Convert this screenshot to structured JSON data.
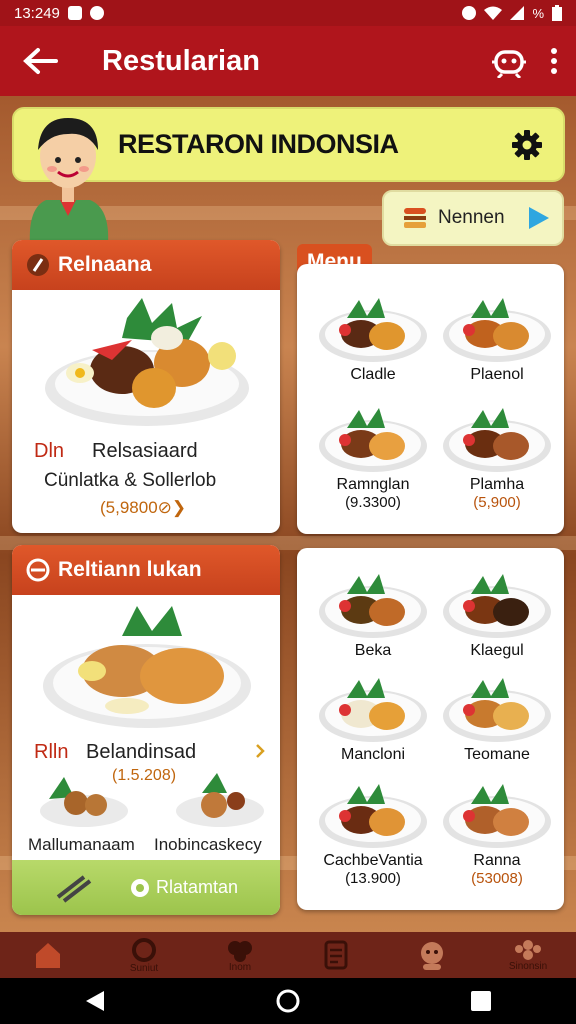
{
  "status_bar": {
    "time": "13:249",
    "battery": "%"
  },
  "app_bar": {
    "title": "Restularian"
  },
  "banner": {
    "title": "RESTARON INDONSIA"
  },
  "menu_button": {
    "label": "Nennen"
  },
  "left_card_1": {
    "header": "Relnaana",
    "line1_prefix": "Dln",
    "line1": "Relsasiaard",
    "line2": "Cünlatka & Sollerlob",
    "price": "(5,9800⊘❯"
  },
  "menu_tag": "Menu",
  "menu_grid_top": [
    {
      "name": "Cladle",
      "price": ""
    },
    {
      "name": "Plaenol",
      "price": ""
    },
    {
      "name": "Ramnglan",
      "price": "(9.3300)"
    },
    {
      "name": "Plamha",
      "price": "(5,900)"
    }
  ],
  "left_card_2": {
    "header": "Reltiann lukan",
    "line1_prefix": "Rlln",
    "line1": "Belandinsad",
    "price": "(1.5.208)",
    "item1": "Mallumanaam",
    "item2": "Inobincaskecy",
    "footer_label": "Rlatamtan"
  },
  "menu_grid_bottom": [
    {
      "name": "Beka",
      "price": ""
    },
    {
      "name": "Klaegul",
      "price": ""
    },
    {
      "name": "Mancloni",
      "price": ""
    },
    {
      "name": "Teomane",
      "price": ""
    },
    {
      "name": "CachbeVantia",
      "price": "(13.900)"
    },
    {
      "name": "Ranna",
      "price": "(53008)"
    }
  ],
  "bottom_nav": [
    "Suniut",
    "Inom",
    "",
    "",
    "Sinonsin"
  ],
  "icons": [
    "back-arrow-icon",
    "robot-icon",
    "more-vert-icon",
    "gear-icon",
    "burger-icon",
    "play-icon",
    "home-icon",
    "settings-icon",
    "dish-icon",
    "list-icon",
    "avatar-icon",
    "group-icon"
  ],
  "colors": {
    "brand_red": "#b0151c",
    "banner": "#eef27a",
    "card_header": "#d9501f",
    "price": "#c0660e",
    "green": "#9cc44c"
  }
}
